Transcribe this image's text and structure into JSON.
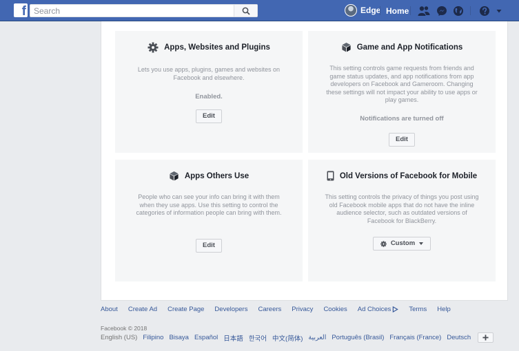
{
  "topbar": {
    "logo_letter": "f",
    "search_placeholder": "Search",
    "user_name": "Edge",
    "home_label": "Home"
  },
  "cards": [
    {
      "title": "Apps, Websites and Plugins",
      "icon": "gear-icon",
      "description": "Lets you use apps, plugins, games and websites on Facebook and elsewhere.",
      "status": "Enabled.",
      "button_label": "Edit"
    },
    {
      "title": "Game and App Notifications",
      "icon": "cube-icon",
      "description": "This setting controls game requests from friends and game status updates, and app notifications from app developers on Facebook and Gameroom. Changing these settings will not impact your ability to use apps or play games.",
      "status": "Notifications are turned off",
      "button_label": "Edit"
    },
    {
      "title": "Apps Others Use",
      "icon": "cube-icon",
      "description": "People who can see your info can bring it with them when they use apps. Use this setting to control the categories of information people can bring with them.",
      "button_label": "Edit"
    },
    {
      "title": "Old Versions of Facebook for Mobile",
      "icon": "mobile-phone-icon",
      "description": "This setting controls the privacy of things you post using old Facebook mobile apps that do not have the inline audience selector, such as outdated versions of Facebook for BlackBerry.",
      "button_label": "Custom"
    }
  ],
  "footer": {
    "links": [
      "About",
      "Create Ad",
      "Create Page",
      "Developers",
      "Careers",
      "Privacy",
      "Cookies",
      "Ad Choices",
      "Terms",
      "Help"
    ],
    "copyright": "Facebook © 2018",
    "current_language": "English (US)",
    "languages": [
      "Filipino",
      "Bisaya",
      "Español",
      "日本語",
      "한국어",
      "中文(简体)",
      "العربية",
      "Português (Brasil)",
      "Français (France)",
      "Deutsch"
    ]
  },
  "colors": {
    "brand_blue": "#4267b2",
    "link_blue": "#365899",
    "card_bg": "#f5f6f7",
    "page_bg": "#e9ebee"
  }
}
